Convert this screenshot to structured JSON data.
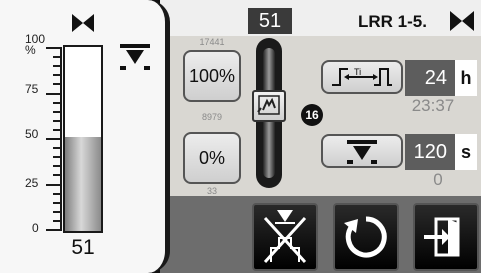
{
  "level": {
    "current_value": "51",
    "fill_percent": 51,
    "scale_labels": [
      "100\n%",
      "75",
      "50",
      "25",
      "0"
    ],
    "top_icon": "valve-icon",
    "alarm_icon": "low-level-alarm-icon"
  },
  "header": {
    "setpoint": "51",
    "title": "LRR 1-5.",
    "valve_icon": "valve-icon"
  },
  "buttons": {
    "top_label": "100%",
    "top_raw": "17441",
    "top_raw_below": "8979",
    "bottom_label": "0%",
    "bottom_raw": "33"
  },
  "slider": {
    "badge": "16",
    "hand_icon": "manual-hand-icon"
  },
  "timer": {
    "value": "24",
    "unit": "h",
    "elapsed": "23:37"
  },
  "delay": {
    "value": "120",
    "unit": "s",
    "count": "0"
  },
  "colors": {
    "panel_bg": "#d9d7d2",
    "dark": "#1a1a1a",
    "value_bg": "#5d5d5d"
  }
}
